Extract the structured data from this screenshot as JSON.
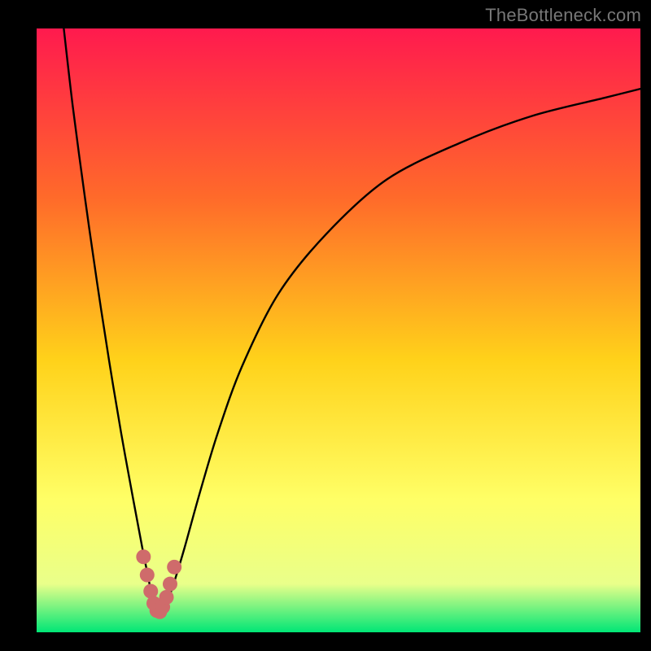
{
  "watermark": "TheBottleneck.com",
  "chart_data": {
    "type": "line",
    "title": "",
    "xlabel": "",
    "ylabel": "",
    "xlim": [
      0,
      100
    ],
    "ylim": [
      0,
      100
    ],
    "grid": false,
    "legend": false,
    "background_gradient": {
      "top": "#ff1a4e",
      "mid_upper": "#ff6a2a",
      "mid": "#ffd21a",
      "mid_lower": "#ffff66",
      "near_bottom": "#e9ff8a",
      "bottom": "#00e676"
    },
    "series": [
      {
        "name": "bottleneck-curve",
        "stroke": "#000000",
        "x": [
          4.5,
          6,
          8,
          10,
          12,
          14,
          16,
          17.5,
          18.5,
          19.2,
          19.8,
          20.5,
          21.2,
          22,
          23,
          24.5,
          27,
          30,
          34,
          40,
          48,
          58,
          70,
          82,
          94,
          100
        ],
        "y": [
          100,
          87,
          72,
          58,
          45,
          33,
          22,
          14,
          9,
          5.5,
          3.5,
          3.2,
          4,
          6,
          9,
          14,
          23,
          33,
          44,
          56,
          66,
          75,
          81,
          85.5,
          88.5,
          90
        ]
      },
      {
        "name": "highlight-dots",
        "stroke": "#cf6b6b",
        "marker": "circle",
        "x": [
          17.7,
          18.3,
          18.9,
          19.4,
          19.9,
          20.4,
          20.9,
          21.5,
          22.1,
          22.8
        ],
        "y": [
          12.5,
          9.5,
          6.8,
          4.8,
          3.6,
          3.4,
          4.2,
          5.8,
          8.0,
          10.8
        ]
      }
    ]
  }
}
